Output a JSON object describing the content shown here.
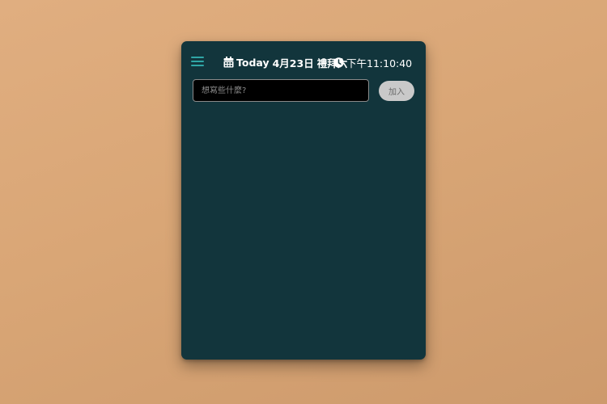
{
  "header": {
    "date_prefix": "Today",
    "date_text": "4月23日",
    "weekday": "禮拜六",
    "time": "下午11:10:40",
    "icons": {
      "menu": "hamburger-menu-icon",
      "date": "calendar-icon",
      "time": "clock-icon"
    }
  },
  "todo": {
    "input_value": "",
    "placeholder": "想寫些什麼?",
    "add_label": "加入",
    "items": []
  },
  "colors": {
    "card_bg": "#12353c",
    "accent": "#2fa6a6",
    "input_bg": "#000000",
    "button_bg": "#c9c9c9"
  }
}
